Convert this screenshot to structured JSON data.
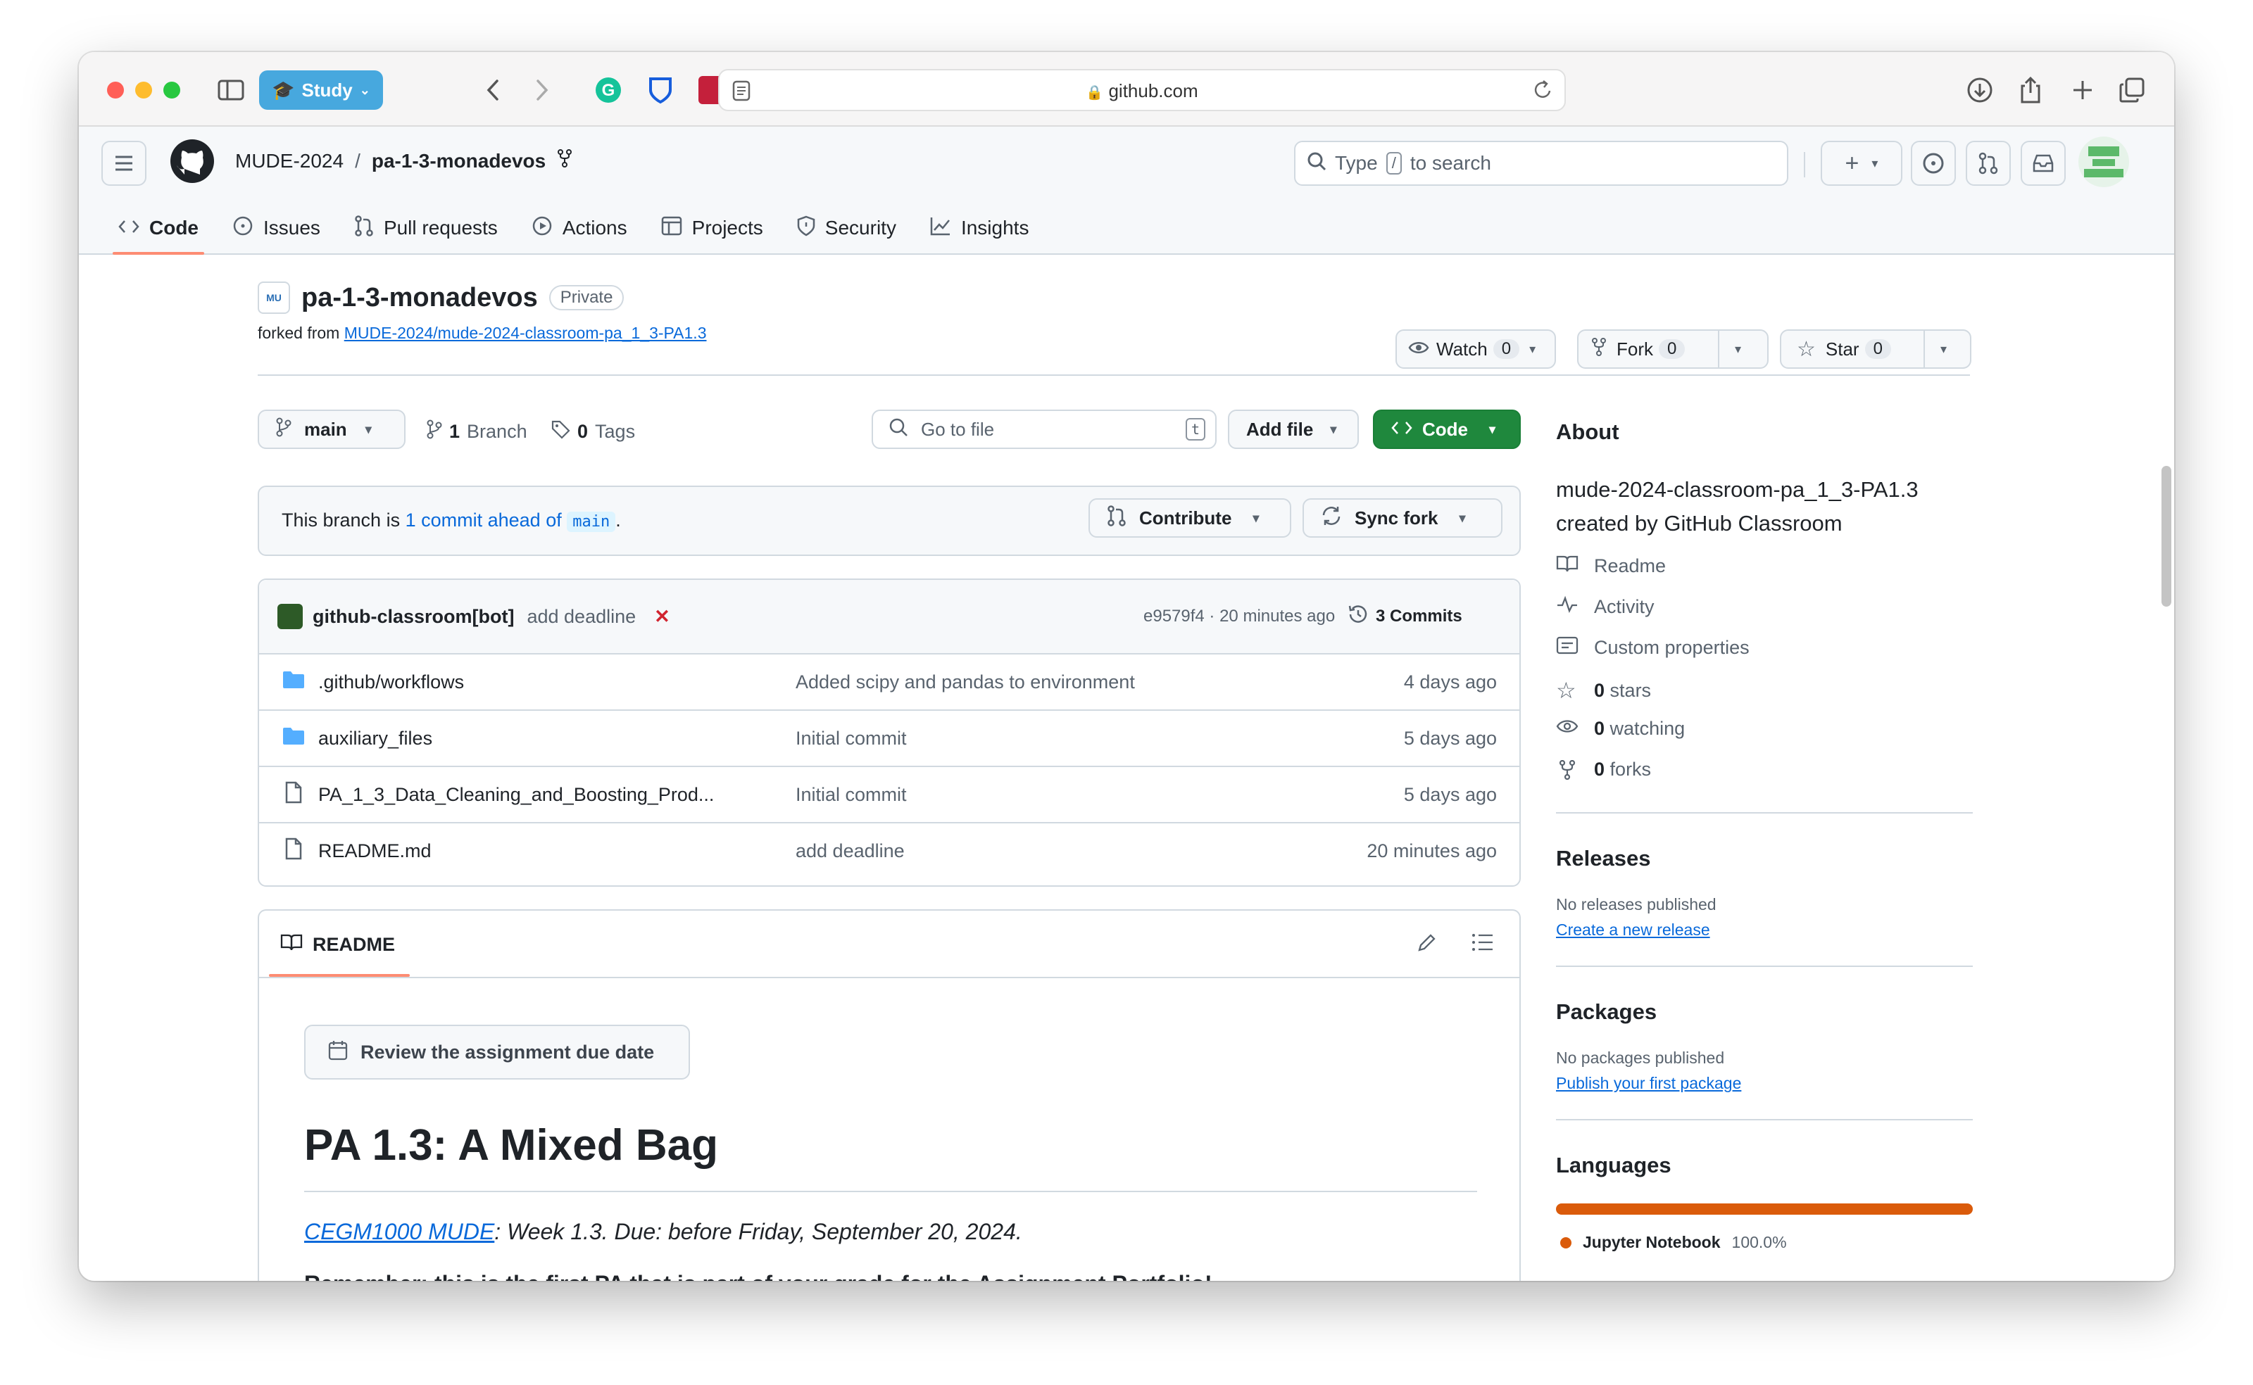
{
  "browser": {
    "study_label": "Study",
    "url": "github.com"
  },
  "header": {
    "owner": "MUDE-2024",
    "separator": "/",
    "repo": "pa-1-3-monadevos",
    "search_prefix": "Type",
    "search_key": "/",
    "search_suffix": "to search"
  },
  "nav": {
    "items": [
      {
        "label": "Code"
      },
      {
        "label": "Issues"
      },
      {
        "label": "Pull requests"
      },
      {
        "label": "Actions"
      },
      {
        "label": "Projects"
      },
      {
        "label": "Security"
      },
      {
        "label": "Insights"
      }
    ]
  },
  "repo": {
    "name": "pa-1-3-monadevos",
    "visibility": "Private",
    "forked_prefix": "forked from",
    "forked_from": "MUDE-2024/mude-2024-classroom-pa_1_3-PA1.3",
    "watch_label": "Watch",
    "watch_count": "0",
    "fork_label": "Fork",
    "fork_count": "0",
    "star_label": "Star",
    "star_count": "0"
  },
  "code_toolbar": {
    "branch": "main",
    "branch_count": "1",
    "branch_label": "Branch",
    "tag_count": "0",
    "tag_label": "Tags",
    "goto_placeholder": "Go to file",
    "goto_key": "t",
    "add_file": "Add file",
    "code_button": "Code"
  },
  "branch_status": {
    "prefix": "This branch is",
    "link": "1 commit ahead of",
    "base": "main",
    "suffix": ".",
    "contribute": "Contribute",
    "sync": "Sync fork"
  },
  "latest_commit": {
    "author": "github-classroom[bot]",
    "message": "add deadline",
    "status": "✕",
    "hash_time": "e9579f4 · 20 minutes ago",
    "commits_label": "3 Commits"
  },
  "files": [
    {
      "name": ".github/workflows",
      "type": "folder",
      "message": "Added scipy and pandas to environment",
      "time": "4 days ago"
    },
    {
      "name": "auxiliary_files",
      "type": "folder",
      "message": "Initial commit",
      "time": "5 days ago"
    },
    {
      "name": "PA_1_3_Data_Cleaning_and_Boosting_Prod...",
      "type": "file",
      "message": "Initial commit",
      "time": "5 days ago"
    },
    {
      "name": "README.md",
      "type": "file",
      "message": "add deadline",
      "time": "20 minutes ago"
    }
  ],
  "readme": {
    "tab": "README",
    "due_button": "Review the assignment due date",
    "title": "PA 1.3: A Mixed Bag",
    "course_link": "CEGM1000 MUDE",
    "subtitle_rest": ": Week 1.3. Due: before Friday, September 20, 2024.",
    "remember": "Remember: this is the first PA that is part of your grade for the Assignment Portfolio!"
  },
  "about": {
    "title": "About",
    "description": "mude-2024-classroom-pa_1_3-PA1.3 created by GitHub Classroom",
    "readme": "Readme",
    "activity": "Activity",
    "custom_properties": "Custom properties",
    "stars_count": "0",
    "stars_label": "stars",
    "watching_count": "0",
    "watching_label": "watching",
    "forks_count": "0",
    "forks_label": "forks"
  },
  "releases": {
    "title": "Releases",
    "none": "No releases published",
    "link": "Create a new release"
  },
  "packages": {
    "title": "Packages",
    "none": "No packages published",
    "link": "Publish your first package"
  },
  "languages": {
    "title": "Languages",
    "name": "Jupyter Notebook",
    "percent": "100.0%",
    "percent_value": 100,
    "color": "#da5b0b"
  }
}
